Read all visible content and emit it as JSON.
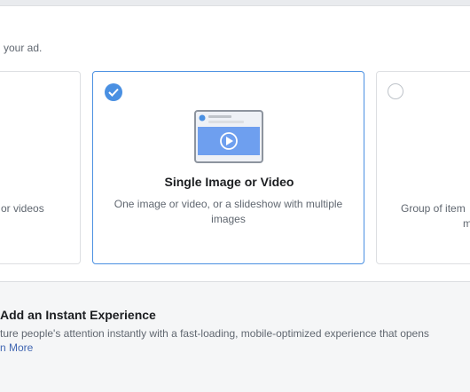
{
  "instruction": "your ad.",
  "cards": {
    "left": {
      "description": "or videos"
    },
    "center": {
      "title": "Single Image or Video",
      "description": "One image or video, or a slideshow with multiple images"
    },
    "right": {
      "description_line1": "Group of item",
      "description_line2": "m"
    }
  },
  "instant_experience": {
    "title": "Add an Instant Experience",
    "description": "ture people's attention instantly with a fast-loading, mobile-optimized experience that opens",
    "link": "n More"
  },
  "colors": {
    "accent": "#4a90e2",
    "link": "#4267b2"
  }
}
